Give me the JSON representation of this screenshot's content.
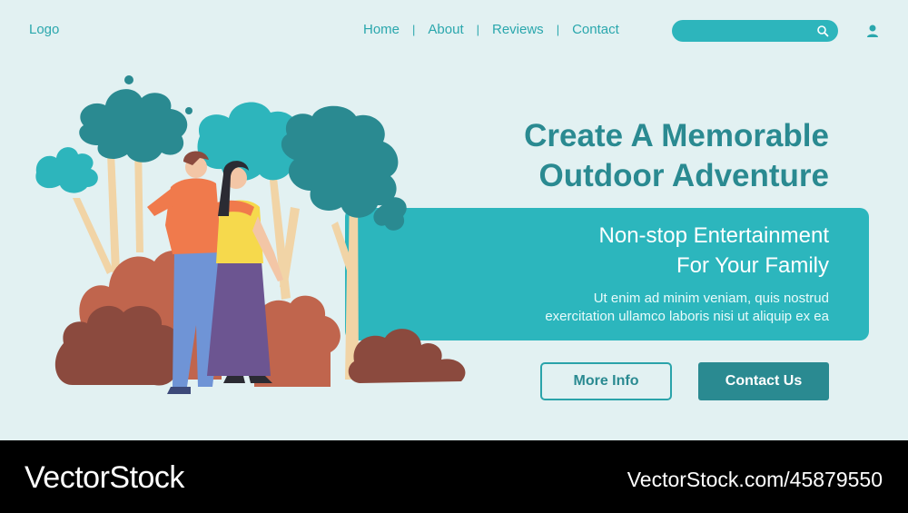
{
  "header": {
    "logo": "Logo",
    "nav": [
      "Home",
      "About",
      "Reviews",
      "Contact"
    ],
    "nav_separator": "|",
    "search_placeholder": "",
    "search_icon": "search-icon",
    "user_icon": "user-icon"
  },
  "hero": {
    "headline_line1": "Create A Memorable",
    "headline_line2": "Outdoor Adventure",
    "subheadline_line1": "Non-stop Entertainment",
    "subheadline_line2": "For Your Family",
    "description_line1": "Ut enim ad minim veniam, quis nostrud",
    "description_line2": "exercitation ullamco laboris nisi ut aliquip ex ea",
    "more_info_label": "More Info",
    "contact_label": "Contact Us"
  },
  "footer": {
    "brand": "VectorStock",
    "url": "VectorStock.com/45879550"
  },
  "colors": {
    "background": "#e2f1f2",
    "accent": "#2cb6bd",
    "dark_accent": "#2a8a91"
  }
}
